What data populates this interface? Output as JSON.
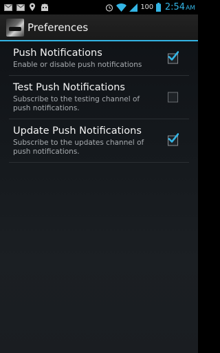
{
  "status_bar": {
    "battery": "100",
    "time": "2:54",
    "time_suffix": "AM",
    "left_icons": [
      "gmail-icon",
      "gmail-icon",
      "location-pin-icon",
      "android-icon"
    ],
    "right_icons": [
      "alarm-icon",
      "wifi-icon",
      "cell-signal-icon",
      "battery-icon"
    ]
  },
  "action_bar": {
    "title": "Preferences"
  },
  "preferences": [
    {
      "title": "Push Notifications",
      "summary": "Enable or disable push notifications",
      "checked": true
    },
    {
      "title": "Test Push Notifications",
      "summary": "Subscribe to the testing channel of push notifications.",
      "checked": false
    },
    {
      "title": "Update Push Notifications",
      "summary": "Subscribe to the updates channel of push notifications.",
      "checked": true
    }
  ],
  "colors": {
    "accent": "#33b5e5",
    "background": "#15191d"
  }
}
